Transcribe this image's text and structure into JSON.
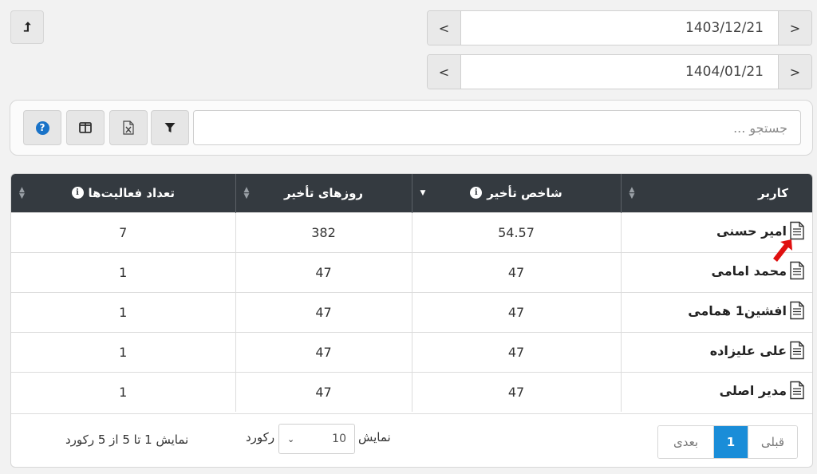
{
  "toolbar_top": {
    "upload_icon": "upload-arrow-icon",
    "upload_glyph": "⮥"
  },
  "dates": [
    {
      "value": "1403/12/21",
      "prev": "<",
      "next": ">"
    },
    {
      "value": "1404/01/21",
      "prev": "<",
      "next": ">"
    }
  ],
  "search": {
    "placeholder": "جستجو ..."
  },
  "toolbar_icons": [
    "help-icon",
    "columns-icon",
    "excel-export-icon",
    "filter-icon"
  ],
  "table": {
    "columns": [
      {
        "label": "کاربر",
        "info": false
      },
      {
        "label": "شاخص تأخیر",
        "info": true
      },
      {
        "label": "روزهای تأخیر",
        "info": false
      },
      {
        "label": "تعداد فعالیت‌ها",
        "info": true
      }
    ],
    "rows": [
      {
        "user": "امیر حسنی",
        "index": "54.57",
        "days": "382",
        "count": "7"
      },
      {
        "user": "محمد امامی",
        "index": "47",
        "days": "47",
        "count": "1"
      },
      {
        "user": "افشین1 همامی",
        "index": "47",
        "days": "47",
        "count": "1"
      },
      {
        "user": "علی علیزاده",
        "index": "47",
        "days": "47",
        "count": "1"
      },
      {
        "user": "مدیر اصلی",
        "index": "47",
        "days": "47",
        "count": "1"
      }
    ]
  },
  "footer": {
    "summary": "نمایش 1 تا 5 از 5 رکورد",
    "show_label": "نمایش",
    "records_label": "رکورد",
    "page_length": "10",
    "pager": {
      "prev": "قبلی",
      "current": "1",
      "next": "بعدی"
    }
  },
  "colors": {
    "header_bg": "#343a40",
    "active_page": "#1a8dd8",
    "arrow": "#e01010"
  }
}
